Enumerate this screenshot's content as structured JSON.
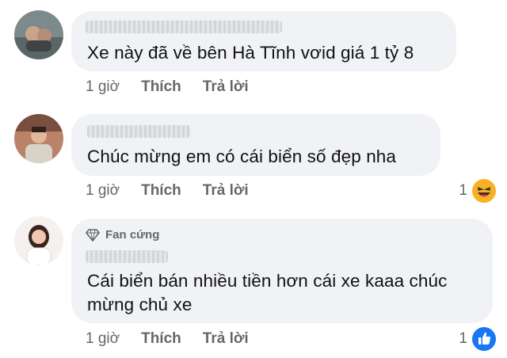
{
  "comments": [
    {
      "text": "Xe này đã về bên Hà Tĩnh vơid giá 1 tỷ 8",
      "time": "1 giờ",
      "like": "Thích",
      "reply": "Trả lời",
      "reaction_count": "",
      "reaction_icon": ""
    },
    {
      "text": "Chúc mừng em có cái biển số đẹp nha",
      "time": "1 giờ",
      "like": "Thích",
      "reply": "Trả lời",
      "reaction_count": "1",
      "reaction_icon": "laughing-emoji-icon"
    },
    {
      "badge": "Fan cứng",
      "badge_icon": "diamond-icon",
      "text_line1": "Cái biển bán nhiều tiền hơn cái xe kaaa chúc",
      "text_line2": "mừng chủ xe",
      "time": "1 giờ",
      "like": "Thích",
      "reply": "Trả lời",
      "reaction_count": "1",
      "reaction_icon": "like-thumb-icon"
    }
  ],
  "colors": {
    "bubble": "#f0f2f5",
    "meta_text": "#65676b",
    "like_blue": "#1877f2",
    "emoji_yellow": "#f7b125"
  }
}
